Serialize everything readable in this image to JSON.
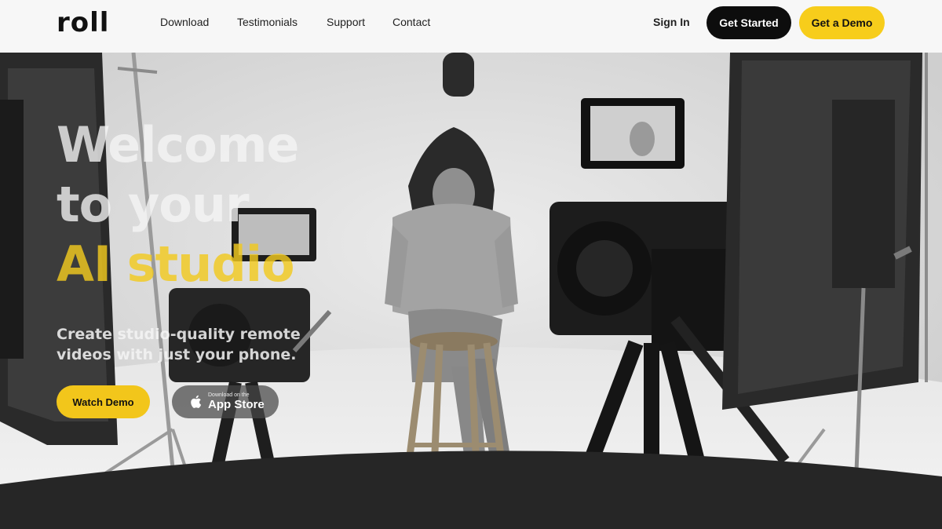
{
  "brand": {
    "logo_text": "roll"
  },
  "nav": {
    "links": [
      "Download",
      "Testimonials",
      "Support",
      "Contact"
    ],
    "sign_in": "Sign In",
    "get_started": "Get Started",
    "get_demo": "Get a Demo"
  },
  "hero": {
    "headline_line1": "Welcome",
    "headline_line2": "to your",
    "headline_line3": "AI studio",
    "subheadline": "Create studio-quality remote videos with just your phone.",
    "watch_demo": "Watch Demo",
    "appstore_small": "Download on the",
    "appstore_big": "App Store"
  },
  "colors": {
    "accent_yellow": "#f7cd1b",
    "dark": "#0d0d0d",
    "nav_bg": "#f7f7f7"
  },
  "icons": [
    "apple-icon"
  ]
}
